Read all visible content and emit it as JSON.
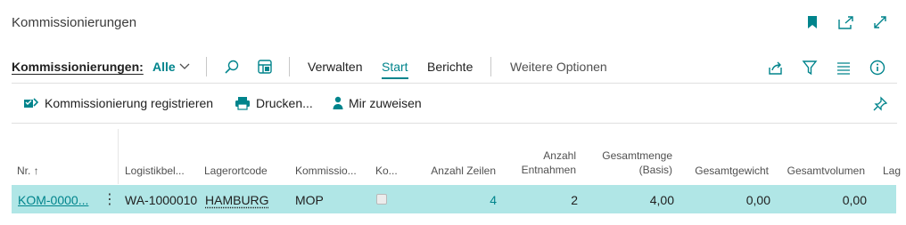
{
  "header": {
    "title": "Kommissionierungen",
    "icons": [
      "bookmark-icon",
      "open-new-window-icon",
      "expand-icon"
    ]
  },
  "actionbar": {
    "list_name": "Kommissionierungen:",
    "filter": "Alle",
    "tabs": [
      "Verwalten",
      "Start",
      "Berichte"
    ],
    "active_tab": "Start",
    "more": "Weitere Optionen"
  },
  "commands": {
    "register": "Kommissionierung registrieren",
    "print": "Drucken...",
    "assign": "Mir zuweisen"
  },
  "table": {
    "headers": {
      "nr": "Nr. ↑",
      "logistik": "Logistikbel...",
      "lagerort": "Lagerortcode",
      "kommissio": "Kommissio...",
      "ko": "Ko...",
      "zeilen": "Anzahl Zeilen",
      "entnahmen_1": "Anzahl",
      "entnahmen_2": "Entnahmen",
      "gesamtmenge_1": "Gesamtmenge",
      "gesamtmenge_2": "(Basis)",
      "gesamtgewicht": "Gesamtgewicht",
      "gesamtvolumen": "Gesamtvolumen",
      "lag": "Lag"
    },
    "row": {
      "nr": "KOM-0000...",
      "logistik": "WA-1000010",
      "lagerort": "HAMBURG",
      "kommissio": "MOP",
      "ko_checked": false,
      "zeilen": "4",
      "entnahmen": "2",
      "gesamtmenge": "4,00",
      "gesamtgewicht": "0,00",
      "gesamtvolumen": "0,00"
    }
  },
  "colors": {
    "accent": "#00848c",
    "selected_row": "#b0e6e6"
  }
}
